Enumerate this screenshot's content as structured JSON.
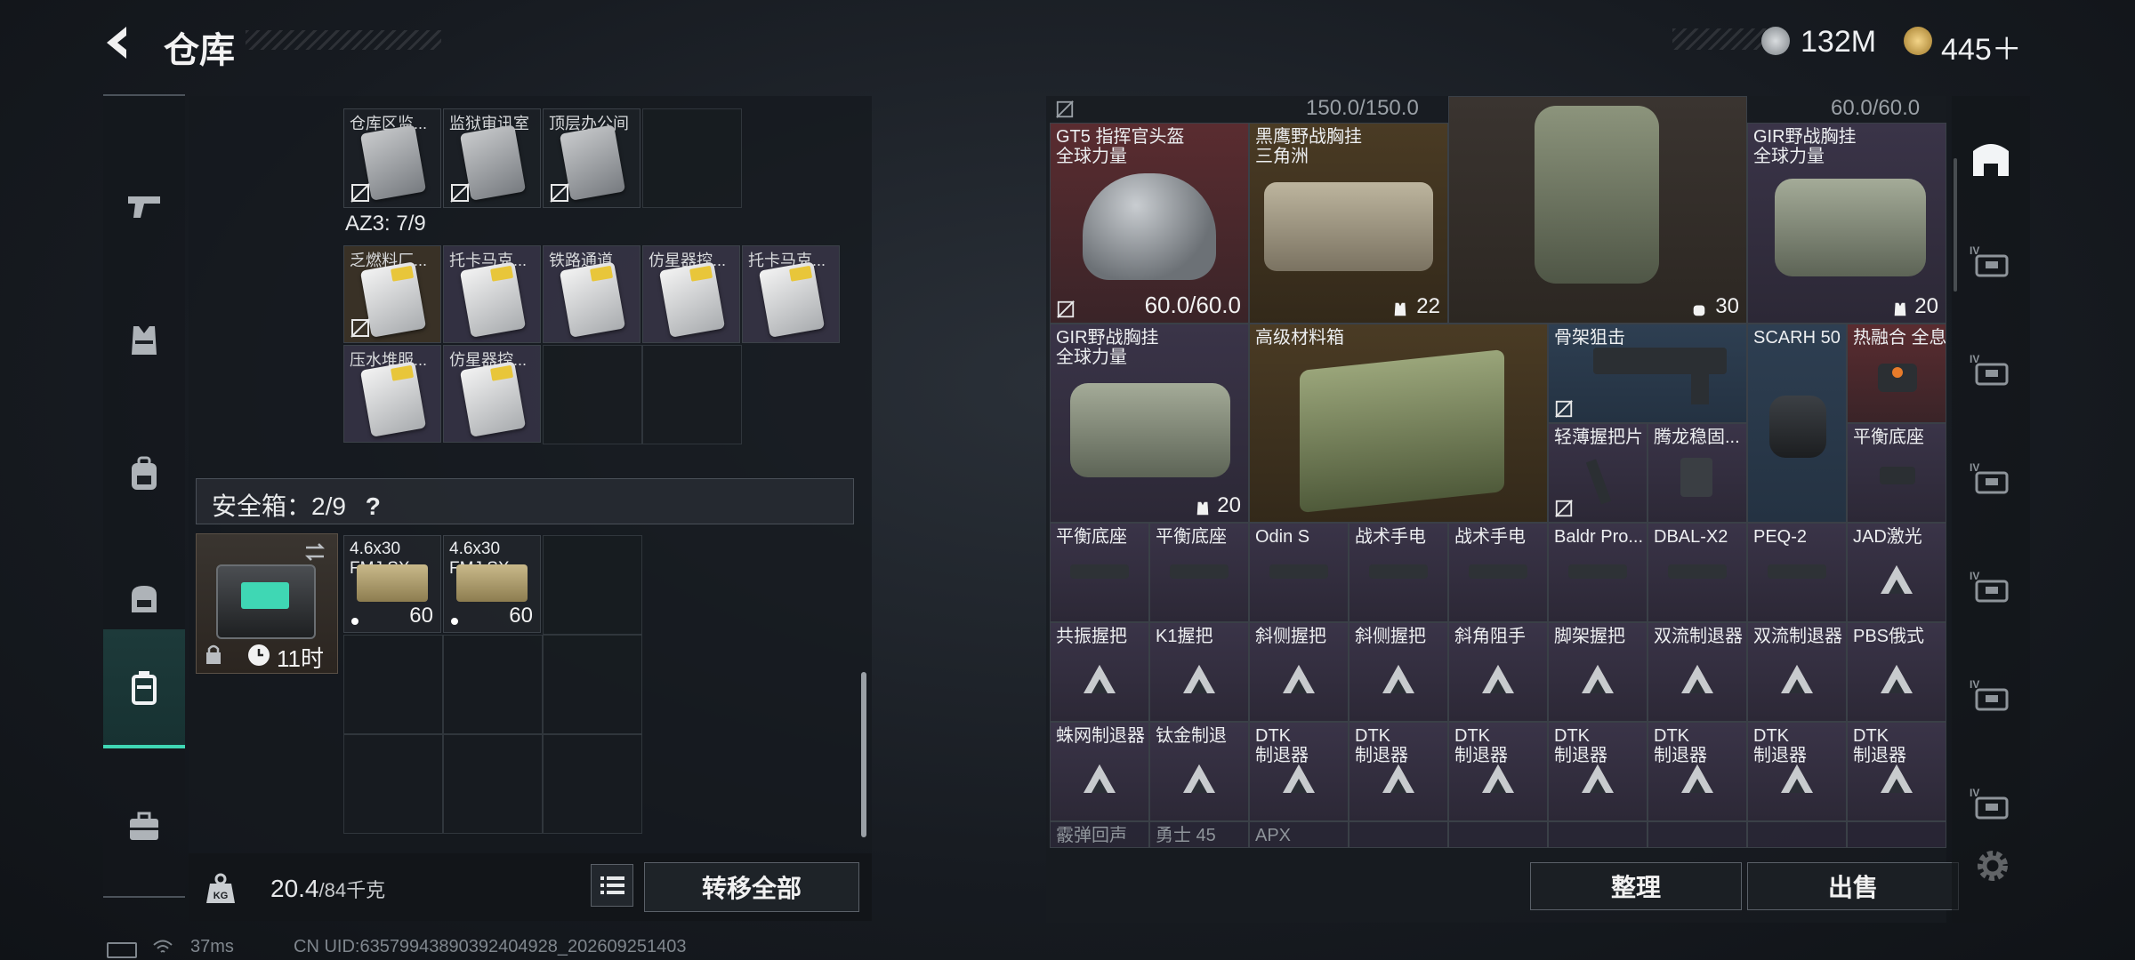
{
  "header": {
    "title": "仓库",
    "currency1_value": "132M",
    "currency2_value": "445＋"
  },
  "left_nav": [
    "pistol-icon",
    "vest-icon",
    "backpack-icon",
    "bag-icon",
    "safebox-icon",
    "toolbox-icon"
  ],
  "container_top": {
    "cards": [
      {
        "label": "仓库区监...",
        "style": "grey"
      },
      {
        "label": "监狱审讯室",
        "style": "grey"
      },
      {
        "label": "顶层办公间",
        "style": "grey"
      }
    ]
  },
  "az3": {
    "label": "AZ3: 7/9",
    "cards": [
      {
        "label": "乏燃料厂..."
      },
      {
        "label": "托卡马克..."
      },
      {
        "label": "铁路通道"
      },
      {
        "label": "仿星器控..."
      },
      {
        "label": "托卡马克..."
      },
      {
        "label": "压水堆服..."
      },
      {
        "label": "仿星器控..."
      }
    ]
  },
  "safebox": {
    "label": "安全箱：2/9",
    "help": "?",
    "timer": "11时",
    "ammo": [
      {
        "name_line1": "4.6x30",
        "name_line2": "FMJ SX",
        "count": "60"
      },
      {
        "name_line1": "4.6x30",
        "name_line2": "FMJ SX",
        "count": "60"
      }
    ]
  },
  "footer_left": {
    "weight": "20.4",
    "weight_max": "/84千克",
    "transfer_label": "转移全部"
  },
  "status_bar": {
    "ping": "37ms",
    "uid": "CN UID:6357994389039240492​8_202609251403"
  },
  "stash": {
    "top_values": [
      "150.0/150.0",
      "60.0/60.0"
    ],
    "items": {
      "helmet": {
        "line1": "GT5 指挥官头盔",
        "line2": "全球力量",
        "count": "60.0/60.0"
      },
      "vest_black": {
        "line1": "黑鹰野战胸挂",
        "line2": "三角洲",
        "count": "22"
      },
      "backpack": {
        "count": "30"
      },
      "gir1": {
        "line1": "GIR野战胸挂",
        "line2": "全球力量",
        "count": "20"
      },
      "gir2": {
        "line1": "GIR野战胸挂",
        "line2": "全球力量",
        "count": "20"
      },
      "crate": {
        "line1": "高级材料箱"
      },
      "stock": {
        "line1": "骨架狙击"
      },
      "scarh": {
        "line1": "SCARH 50"
      },
      "sight": {
        "line1": "热融合 全息"
      },
      "grip_light": {
        "line1": "轻薄握把片"
      },
      "tenglong": {
        "line1": "腾龙稳固..."
      },
      "balance1": {
        "line1": "平衡底座"
      }
    },
    "row3": [
      "平衡底座",
      "平衡底座",
      "Odin S",
      "战术手电",
      "战术手电",
      "Baldr Pro...",
      "DBAL-X2",
      "PEQ-2",
      "JAD激光"
    ],
    "row4": [
      "共振握把",
      "K1握把",
      "斜侧握把",
      "斜侧握把",
      "斜角阻手",
      "脚架握把",
      "双流制退器",
      "双流制退器",
      "PBS俄式"
    ],
    "row5": [
      {
        "line1": "蛛网制退器",
        "line2": ""
      },
      {
        "line1": "钛金制退",
        "line2": ""
      },
      {
        "line1": "DTK",
        "line2": "制退器"
      },
      {
        "line1": "DTK",
        "line2": "制退器"
      },
      {
        "line1": "DTK",
        "line2": "制退器"
      },
      {
        "line1": "DTK",
        "line2": "制退器"
      },
      {
        "line1": "DTK",
        "line2": "制退器"
      },
      {
        "line1": "DTK",
        "line2": "制退器"
      },
      {
        "line1": "DTK",
        "line2": "制退器"
      }
    ],
    "row6": [
      "霰弹回声",
      "勇士 45",
      "APX"
    ]
  },
  "footer_right": {
    "sort_label": "整理",
    "sell_label": "出售"
  },
  "right_tabs": [
    "home-tab-icon",
    "iv-case-icon",
    "iv-case-icon",
    "iv-case-icon",
    "iv-case-icon",
    "iv-case-icon",
    "iv-case-icon"
  ],
  "colors": {
    "accent": "#3fd7b4",
    "red_rarity": "#5a2c30",
    "blue_rarity": "#2e3f52",
    "purple_rarity": "#3a3448",
    "gold_rarity": "#4a3b24"
  }
}
